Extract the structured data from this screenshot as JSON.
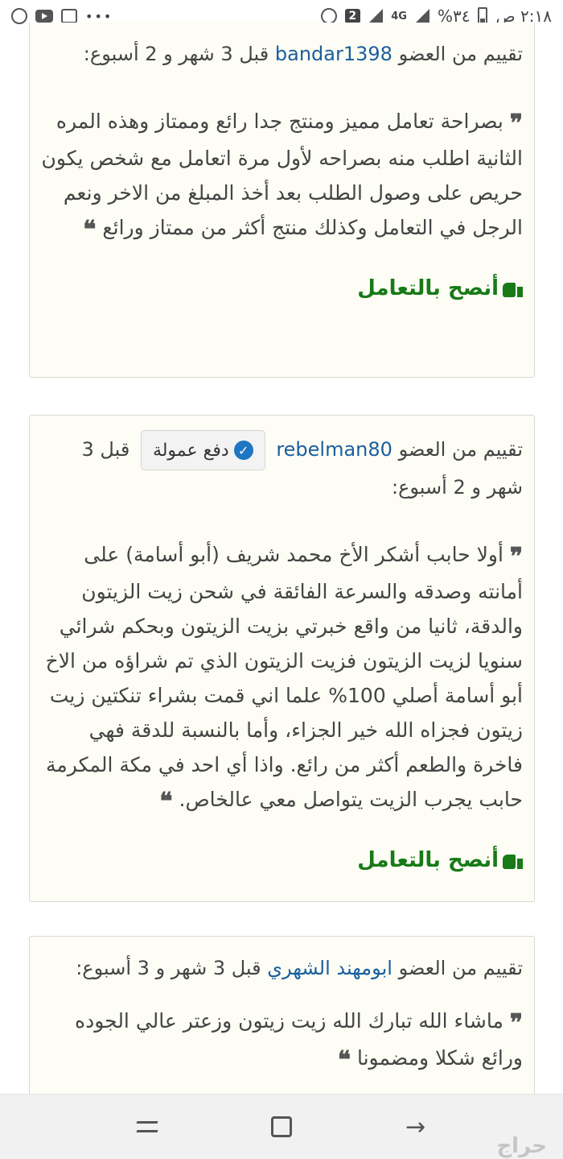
{
  "status_bar": {
    "time": "٢:١٨ ص",
    "battery": "%٣٤",
    "network": "4G",
    "badge": "2",
    "dots": "•••"
  },
  "reviews": [
    {
      "prefix": "تقييم من العضو",
      "member": "bandar1398",
      "time": "قبل 3 شهر و 2 أسبوع:",
      "badge": "",
      "text": "بصراحة تعامل مميز ومنتج جدا رائع وممتاز وهذه المره الثانية اطلب منه بصراحه لأول مرة اتعامل مع شخص يكون حريص على وصول الطلب بعد أخذ المبلغ من الاخر ونعم الرجل في التعامل وكذلك منتج أكثر من ممتاز ورائع",
      "recommend": "أنصح بالتعامل"
    },
    {
      "prefix": "تقييم من العضو",
      "member": "rebelman80",
      "time": "قبل 3 شهر و 2 أسبوع:",
      "badge": "دفع عمولة",
      "text": "أولا حابب أشكر الأخ محمد شريف (أبو أسامة) على أمانته وصدقه والسرعة الفائقة في شحن زيت الزيتون والدقة، ثانيا من واقع خبرتي بزيت الزيتون وبحكم شرائي سنويا لزيت الزيتون فزيت الزيتون الذي تم شراؤه من الاخ أبو أسامة أصلي 100% علما اني قمت بشراء تنكتين زيت زيتون فجزاه الله خير الجزاء، وأما بالنسبة للدقة فهي فاخرة والطعم أكثر من رائع. واذا أي احد في مكة المكرمة حابب يجرب الزيت يتواصل معي عالخاص.",
      "recommend": "أنصح بالتعامل"
    },
    {
      "prefix": "تقييم من العضو",
      "member": "ابومهند الشهري",
      "time": "قبل 3 شهر و 3 أسبوع:",
      "badge": "",
      "text": "ماشاء الله تبارك الله زيت زيتون وزعتر عالي الجوده ورائع شكلا ومضمونا",
      "recommend": ""
    }
  ],
  "quote_open": "❞",
  "quote_close": "❝",
  "watermark": "حراج",
  "colors": {
    "member_link": "#1a5f9e",
    "recommend": "#177a17",
    "card_bg": "#fdfdf5",
    "verified": "#1f76c2"
  }
}
